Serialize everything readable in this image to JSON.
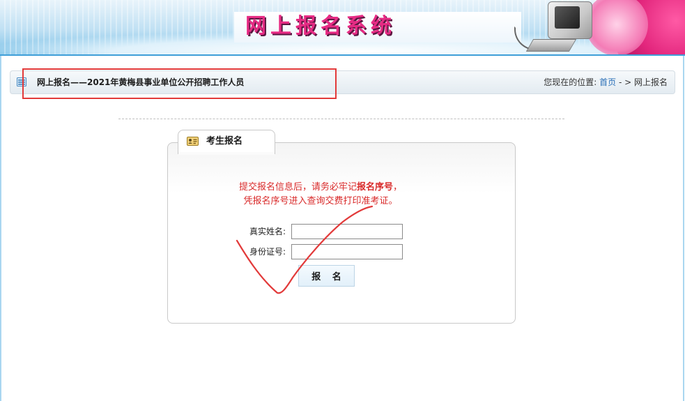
{
  "header": {
    "banner_title": "网上报名系统"
  },
  "location_bar": {
    "title": "网上报名——2021年黄梅县事业单位公开招聘工作人员",
    "breadcrumb_prefix": "您现在的位置:",
    "breadcrumb_home": "首页",
    "breadcrumb_separator": " - >",
    "breadcrumb_current": "网上报名"
  },
  "panel": {
    "tab_label": "考生报名",
    "notice_line1_prefix": "提交报名信息后，请务必牢记",
    "notice_line1_emphasis": "报名序号",
    "notice_line1_suffix": "，",
    "notice_line2": "凭报名序号进入查询交费打印准考证。",
    "name_label": "真实姓名:",
    "name_value": "",
    "id_label": "身份证号:",
    "id_value": "",
    "submit_label": "报 名"
  },
  "colors": {
    "notice_red": "#d92a2a",
    "annotation_red": "#e23a3a",
    "link_blue": "#2a6fb7",
    "banner_pink": "#e62b84"
  },
  "icons": {
    "location_icon": "list-icon",
    "tab_icon": "id-card-icon"
  }
}
